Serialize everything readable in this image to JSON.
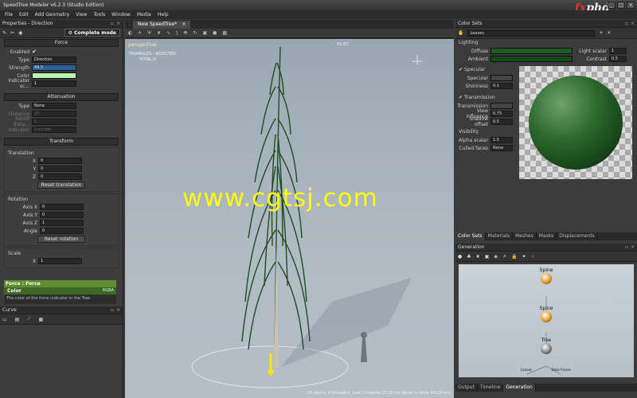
{
  "window": {
    "title": "SpeedTree Modeler v6.2.3 (Studio Edition)",
    "logo": "fxphd",
    "controls": [
      "_",
      "□",
      "×"
    ]
  },
  "menu": [
    "File",
    "Edit",
    "Add Geometry",
    "View",
    "Tools",
    "Window",
    "Media",
    "Help"
  ],
  "properties": {
    "title": "Properties - Direction",
    "mode": "Complete mode",
    "force": {
      "header": "Force",
      "enabled_label": "Enabled",
      "type_label": "Type",
      "type_value": "Direction",
      "strength_label": "Strength",
      "strength_value": "49.5",
      "color_label": "Color",
      "indicator_label": "Indicator sc...",
      "indicator_value": "1"
    },
    "attenuation": {
      "header": "Attenuation",
      "type_label": "Type",
      "type_value": "None",
      "distance_label": "Distance",
      "distance_value": "25",
      "falloff_label": "Falloff dista...",
      "falloff_value": "5",
      "indicator_label": "Indicator",
      "indicator_value": "Inverted"
    },
    "transform": {
      "header": "Transform",
      "translation": {
        "label": "Translation",
        "x": "0",
        "y": "0",
        "z": "0",
        "reset": "Reset translation"
      },
      "rotation": {
        "label": "Rotation",
        "axis_x": "0",
        "axis_y": "0",
        "axis_z": "1",
        "angle": "0",
        "reset": "Reset rotation"
      },
      "scale": {
        "label": "Scale",
        "x": "1",
        "y": "1"
      },
      "labels": {
        "x": "X",
        "y": "Y",
        "z": "Z",
        "axis_x": "Axis X",
        "axis_y": "Axis Y",
        "axis_z": "Axis Z",
        "angle": "Angle"
      }
    },
    "help": {
      "title": "Force : Force",
      "item": "Color",
      "item_tag": "RGBA",
      "text": "The color of the force indicator in the Tree"
    }
  },
  "curve": {
    "title": "Curve"
  },
  "viewport": {
    "tab": "New SpeedTree*",
    "label": "perspective",
    "stats1": "TRIANGLES - SELECTED",
    "stats2": "TOTAL:0",
    "fps": "41.67",
    "status": "18 cpu(s), 8 thread(s), Last Compute 15.16 ms (draw to draw 49.20 ms)",
    "watermark": "www.cgtsj.com"
  },
  "color_sets": {
    "title": "Color Sets",
    "set": "Leaves",
    "lighting": "Lighting",
    "diffuse": "Diffuse",
    "ambient": "Ambient",
    "light_scalar_label": "Light scalar",
    "light_scalar": "1",
    "contrast_label": "Contrast",
    "contrast": "0.5",
    "specular_header": "Specular",
    "specular": "Specular",
    "shininess_label": "Shininess",
    "shininess": "0.1",
    "transmission_header": "Transmission",
    "transmission": "Transmission",
    "view_influence_label": "View influence",
    "view_influence": "0.75",
    "shadow_offset_label": "Shadow offset",
    "shadow_offset": "0.5",
    "visibility": "Visibility",
    "alpha_label": "Alpha scalar",
    "alpha": "1.5",
    "culled_label": "Culled faces",
    "culled": "None",
    "diffuse_color": "#1f5a22",
    "ambient_color": "#154a1a"
  },
  "right_tabs": [
    "Color Sets",
    "Materials",
    "Meshes",
    "Masks",
    "Displacements"
  ],
  "generation": {
    "title": "Generation",
    "nodes": [
      "Spine",
      "Spine",
      "Tree"
    ],
    "small_labels": [
      "Leaves",
      "Base Forces"
    ],
    "tabs": [
      "Output",
      "Timeline",
      "Generation"
    ]
  }
}
